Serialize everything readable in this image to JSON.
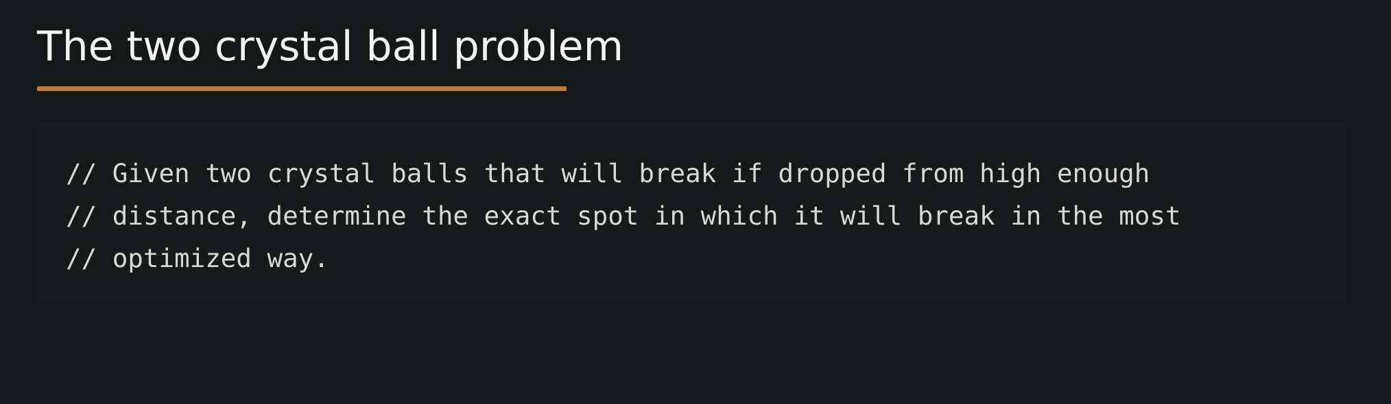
{
  "slide": {
    "title": "The two crystal ball problem",
    "accent_color": "#b97a3d",
    "background_color": "#151818"
  },
  "code": {
    "lines": [
      "// Given two crystal balls that will break if dropped from high enough",
      "// distance, determine the exact spot in which it will break in the most",
      "// optimized way."
    ]
  }
}
